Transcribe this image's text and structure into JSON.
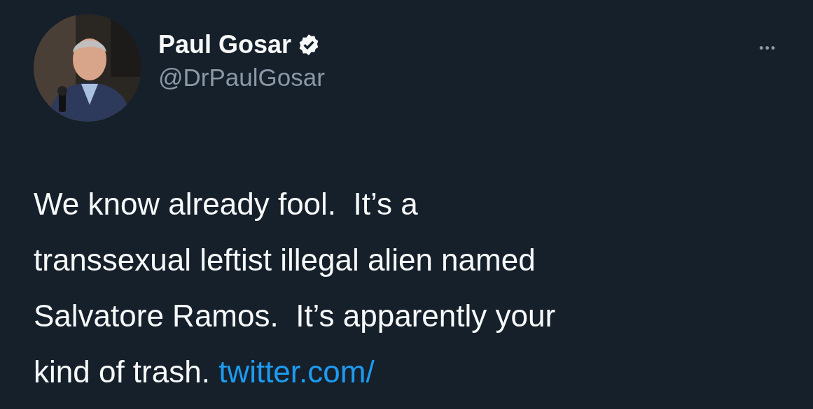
{
  "author": {
    "name": "Paul Gosar",
    "verified": true,
    "handle": "@DrPaulGosar"
  },
  "more_button": "•••",
  "tweet": {
    "lines": [
      "We know already fool.  It’s a",
      "transsexual leftist illegal alien named",
      "Salvatore Ramos.  It’s apparently your",
      "kind of trash."
    ],
    "link": "twitter.com/"
  }
}
